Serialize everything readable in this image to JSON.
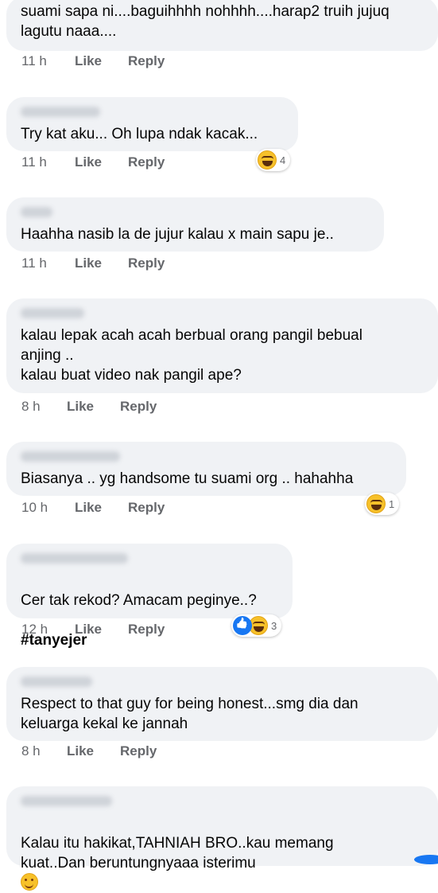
{
  "comments": [
    {
      "text": "suami sapa ni....baguihhhh nohhhh....harap2 truih jujuq\nlagutu naaa....",
      "time": "11 h",
      "like": "Like",
      "reply": "Reply"
    },
    {
      "text": "Try kat aku... Oh lupa ndak kacak...",
      "time": "11 h",
      "like": "Like",
      "reply": "Reply",
      "reaction": {
        "icons": [
          "haha"
        ],
        "count": "4"
      }
    },
    {
      "text": "Haahha nasib la de jujur kalau x main sapu je..",
      "time": "11 h",
      "like": "Like",
      "reply": "Reply"
    },
    {
      "text": "kalau lepak acah acah berbual orang pangil bebual\nanjing ..\nkalau buat video nak pangil ape?",
      "time": "8 h",
      "like": "Like",
      "reply": "Reply"
    },
    {
      "text": "Biasanya .. yg handsome tu suami org .. hahahha",
      "time": "10 h",
      "like": "Like",
      "reply": "Reply",
      "reaction": {
        "icons": [
          "haha"
        ],
        "count": "1"
      }
    },
    {
      "text": "Cer tak rekod? Amacam peginye..?",
      "hashtag": "#tanyejer",
      "time": "12 h",
      "like": "Like",
      "reply": "Reply",
      "reaction": {
        "icons": [
          "like",
          "haha"
        ],
        "count": "3"
      }
    },
    {
      "text": "Respect to that guy for being honest...smg dia dan\nkeluarga kekal ke jannah",
      "time": "8 h",
      "like": "Like",
      "reply": "Reply"
    },
    {
      "text": "Kalau itu hakikat,TAHNIAH BRO..kau memang\nkuat..Dan beruntungnyaaa isterimu",
      "emoji": "smile-emoji"
    }
  ],
  "colors": {
    "bubble": "#f0f2f5",
    "meta_text": "#65676b",
    "primary_text": "#050505",
    "accent": "#1877f2"
  }
}
